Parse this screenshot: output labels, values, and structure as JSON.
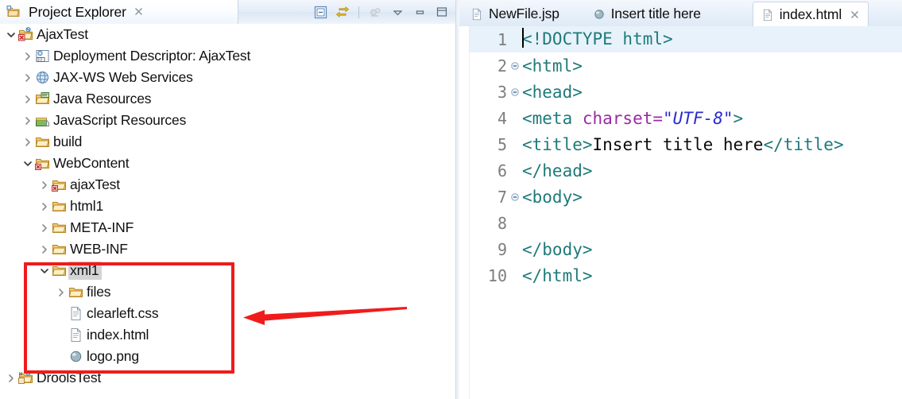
{
  "explorer": {
    "title": "Project Explorer",
    "close_label": "✖",
    "toolbar": [
      {
        "name": "collapse-all-icon",
        "tooltip": "Collapse All"
      },
      {
        "name": "link-with-editor-icon",
        "tooltip": "Link With Editor"
      },
      {
        "name": "focus-on-active-task-icon",
        "tooltip": "Focus on Active Task"
      },
      {
        "name": "view-menu-icon",
        "tooltip": "View Menu"
      },
      {
        "name": "minimize-icon",
        "tooltip": "Minimize"
      },
      {
        "name": "maximize-icon",
        "tooltip": "Maximize"
      }
    ],
    "tree": [
      {
        "label": "AjaxTest",
        "indent": 0,
        "twisty": "down",
        "icon": "web-project-icon",
        "selected": false
      },
      {
        "label": "Deployment Descriptor: AjaxTest",
        "indent": 1,
        "twisty": "right",
        "icon": "deployment-descriptor-icon",
        "selected": false
      },
      {
        "label": "JAX-WS Web Services",
        "indent": 1,
        "twisty": "right",
        "icon": "web-service-icon",
        "selected": false
      },
      {
        "label": "Java Resources",
        "indent": 1,
        "twisty": "right",
        "icon": "java-resources-icon",
        "selected": false
      },
      {
        "label": "JavaScript Resources",
        "indent": 1,
        "twisty": "right",
        "icon": "javascript-resources-icon",
        "selected": false
      },
      {
        "label": "build",
        "indent": 1,
        "twisty": "right",
        "icon": "folder-icon",
        "selected": false
      },
      {
        "label": "WebContent",
        "indent": 1,
        "twisty": "down",
        "icon": "web-folder-icon",
        "selected": false
      },
      {
        "label": "ajaxTest",
        "indent": 2,
        "twisty": "right",
        "icon": "web-folder-icon",
        "selected": false
      },
      {
        "label": "html1",
        "indent": 2,
        "twisty": "right",
        "icon": "folder-icon",
        "selected": false
      },
      {
        "label": "META-INF",
        "indent": 2,
        "twisty": "right",
        "icon": "folder-icon",
        "selected": false
      },
      {
        "label": "WEB-INF",
        "indent": 2,
        "twisty": "right",
        "icon": "folder-icon",
        "selected": false
      },
      {
        "label": "xml1",
        "indent": 2,
        "twisty": "down",
        "icon": "folder-icon",
        "selected": true
      },
      {
        "label": "files",
        "indent": 3,
        "twisty": "right",
        "icon": "folder-icon",
        "selected": false
      },
      {
        "label": "clearleft.css",
        "indent": 3,
        "twisty": "none",
        "icon": "file-icon",
        "selected": false
      },
      {
        "label": "index.html",
        "indent": 3,
        "twisty": "none",
        "icon": "file-icon",
        "selected": false
      },
      {
        "label": "logo.png",
        "indent": 3,
        "twisty": "none",
        "icon": "image-file-icon",
        "selected": false
      },
      {
        "label": "DroolsTest",
        "indent": 0,
        "twisty": "right",
        "icon": "maven-project-icon",
        "selected": false
      }
    ]
  },
  "editor": {
    "tabs": [
      {
        "label": "NewFile.jsp",
        "icon": "file-icon",
        "active": false,
        "closable": false
      },
      {
        "label": "Insert title here",
        "icon": "browser-icon",
        "active": false,
        "closable": false
      },
      {
        "label": "index.html",
        "icon": "file-icon",
        "active": true,
        "closable": true
      }
    ],
    "close_label": "✖",
    "lines": [
      {
        "no": "1",
        "fold": false,
        "current": true,
        "tokens": [
          {
            "t": "caret",
            "v": ""
          },
          {
            "t": "tag",
            "v": "<!DOCTYPE html>"
          }
        ]
      },
      {
        "no": "2",
        "fold": true,
        "current": false,
        "tokens": [
          {
            "t": "tag",
            "v": "<html>"
          }
        ]
      },
      {
        "no": "3",
        "fold": true,
        "current": false,
        "tokens": [
          {
            "t": "tag",
            "v": "<head>"
          }
        ]
      },
      {
        "no": "4",
        "fold": false,
        "current": false,
        "tokens": [
          {
            "t": "tag",
            "v": "<meta "
          },
          {
            "t": "attr",
            "v": "charset="
          },
          {
            "t": "val",
            "v": "\"UTF-8\""
          },
          {
            "t": "tag",
            "v": ">"
          }
        ]
      },
      {
        "no": "5",
        "fold": false,
        "current": false,
        "tokens": [
          {
            "t": "tag",
            "v": "<title>"
          },
          {
            "t": "txt",
            "v": "Insert title here"
          },
          {
            "t": "tag",
            "v": "</title>"
          }
        ]
      },
      {
        "no": "6",
        "fold": false,
        "current": false,
        "tokens": [
          {
            "t": "tag",
            "v": "</head>"
          }
        ]
      },
      {
        "no": "7",
        "fold": true,
        "current": false,
        "tokens": [
          {
            "t": "tag",
            "v": "<body>"
          }
        ]
      },
      {
        "no": "8",
        "fold": false,
        "current": false,
        "tokens": [
          {
            "t": "txt",
            "v": ""
          }
        ]
      },
      {
        "no": "9",
        "fold": false,
        "current": false,
        "tokens": [
          {
            "t": "tag",
            "v": "</body>"
          }
        ]
      },
      {
        "no": "10",
        "fold": false,
        "current": false,
        "tokens": [
          {
            "t": "tag",
            "v": "</html>"
          }
        ]
      }
    ]
  },
  "annotations": {
    "highlight_color": "#ee1c1c",
    "box": {
      "name": "xml1-folder-highlight-box"
    },
    "arrow": {
      "name": "pointer-arrow",
      "direction": "left"
    }
  }
}
